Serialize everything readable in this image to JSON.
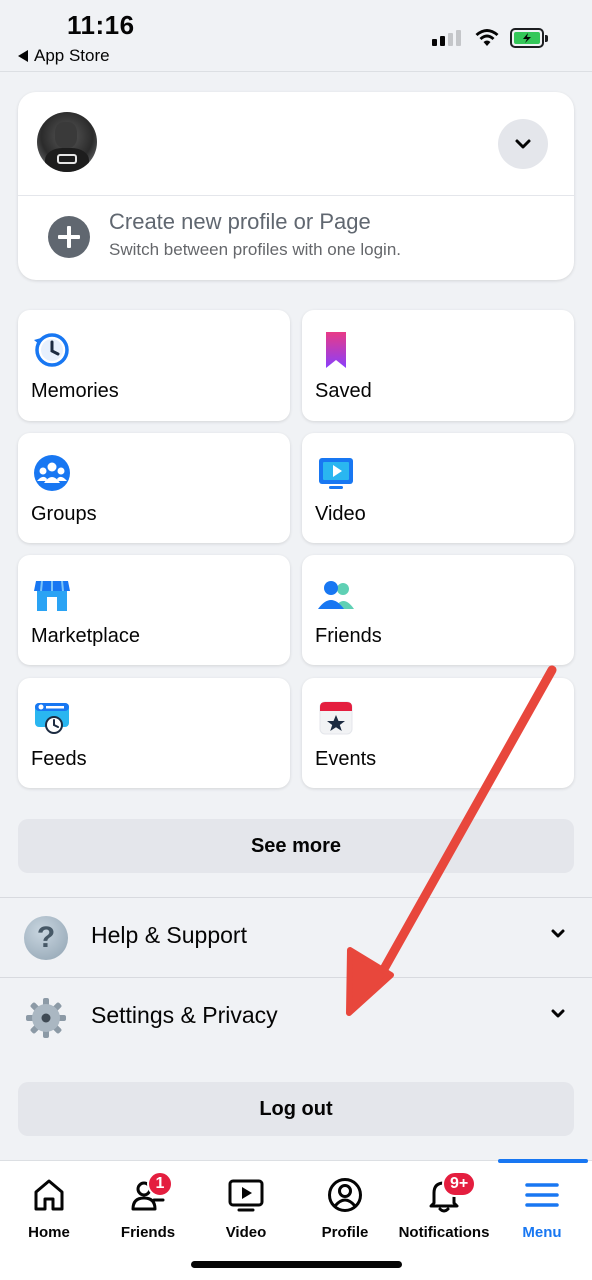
{
  "status_bar": {
    "time": "11:16",
    "back_label": "App Store"
  },
  "profile": {
    "create_title": "Create new profile or Page",
    "create_subtitle": "Switch between profiles with one login."
  },
  "shortcuts": [
    {
      "label": "Memories",
      "icon": "memories-icon"
    },
    {
      "label": "Saved",
      "icon": "saved-icon"
    },
    {
      "label": "Groups",
      "icon": "groups-icon"
    },
    {
      "label": "Video",
      "icon": "video-icon"
    },
    {
      "label": "Marketplace",
      "icon": "marketplace-icon"
    },
    {
      "label": "Friends",
      "icon": "friends-icon"
    },
    {
      "label": "Feeds",
      "icon": "feeds-icon"
    },
    {
      "label": "Events",
      "icon": "events-icon"
    }
  ],
  "see_more_label": "See more",
  "sections": [
    {
      "label": "Help & Support",
      "icon": "help-icon"
    },
    {
      "label": "Settings & Privacy",
      "icon": "gear-icon"
    }
  ],
  "logout_label": "Log out",
  "tabs": [
    {
      "label": "Home",
      "icon": "home-icon"
    },
    {
      "label": "Friends",
      "icon": "friends-tab-icon",
      "badge": "1"
    },
    {
      "label": "Video",
      "icon": "video-tab-icon"
    },
    {
      "label": "Profile",
      "icon": "profile-tab-icon"
    },
    {
      "label": "Notifications",
      "icon": "bell-icon",
      "badge": "9+"
    },
    {
      "label": "Menu",
      "icon": "menu-icon",
      "active": true
    }
  ],
  "colors": {
    "accent": "#1877f2",
    "badge": "#e41e3f",
    "annotation_arrow": "#e8473c"
  }
}
